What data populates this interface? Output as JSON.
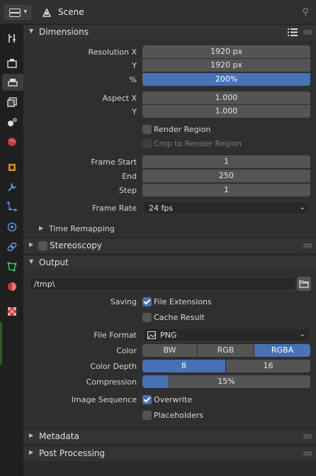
{
  "header": {
    "title": "Scene"
  },
  "sections": {
    "dimensions": {
      "title": "Dimensions",
      "resolution_x_label": "Resolution X",
      "resolution_x": "1920 px",
      "resolution_y_label": "Y",
      "resolution_y": "1920 px",
      "percent_label": "%",
      "percent": "200%",
      "aspect_x_label": "Aspect X",
      "aspect_x": "1.000",
      "aspect_y_label": "Y",
      "aspect_y": "1.000",
      "render_region": "Render Region",
      "render_region_checked": false,
      "crop_region": "Crop to Render Region",
      "crop_region_checked": false,
      "frame_start_label": "Frame Start",
      "frame_start": "1",
      "frame_end_label": "End",
      "frame_end": "250",
      "frame_step_label": "Step",
      "frame_step": "1",
      "frame_rate_label": "Frame Rate",
      "frame_rate": "24 fps",
      "time_remapping": "Time Remapping"
    },
    "stereoscopy": {
      "title": "Stereoscopy",
      "checked": false
    },
    "output": {
      "title": "Output",
      "path": "/tmp\\",
      "saving_label": "Saving",
      "file_extensions": "File Extensions",
      "file_extensions_checked": true,
      "cache_result": "Cache Result",
      "cache_result_checked": false,
      "file_format_label": "File Format",
      "file_format": "PNG",
      "color_label": "Color",
      "color_options": [
        "BW",
        "RGB",
        "RGBA"
      ],
      "color_selected": "RGBA",
      "color_depth_label": "Color Depth",
      "color_depth_options": [
        "8",
        "16"
      ],
      "color_depth_selected": "8",
      "compression_label": "Compression",
      "compression": "15%",
      "compression_fraction": 0.15,
      "image_sequence_label": "Image Sequence",
      "overwrite": "Overwrite",
      "overwrite_checked": true,
      "placeholders": "Placeholders",
      "placeholders_checked": false
    },
    "metadata": {
      "title": "Metadata"
    },
    "post_processing": {
      "title": "Post Processing"
    }
  },
  "colors": {
    "accent": "#4772b3",
    "field": "#545454",
    "panel": "#2b2b2b"
  },
  "tabs": [
    "tool-icon",
    "render-icon",
    "output-icon",
    "view-layer-icon",
    "scene-icon",
    "world-icon",
    "object-icon",
    "modifier-icon",
    "particles-icon",
    "physics-icon",
    "constraints-icon",
    "data-icon",
    "material-icon",
    "texture-icon"
  ]
}
